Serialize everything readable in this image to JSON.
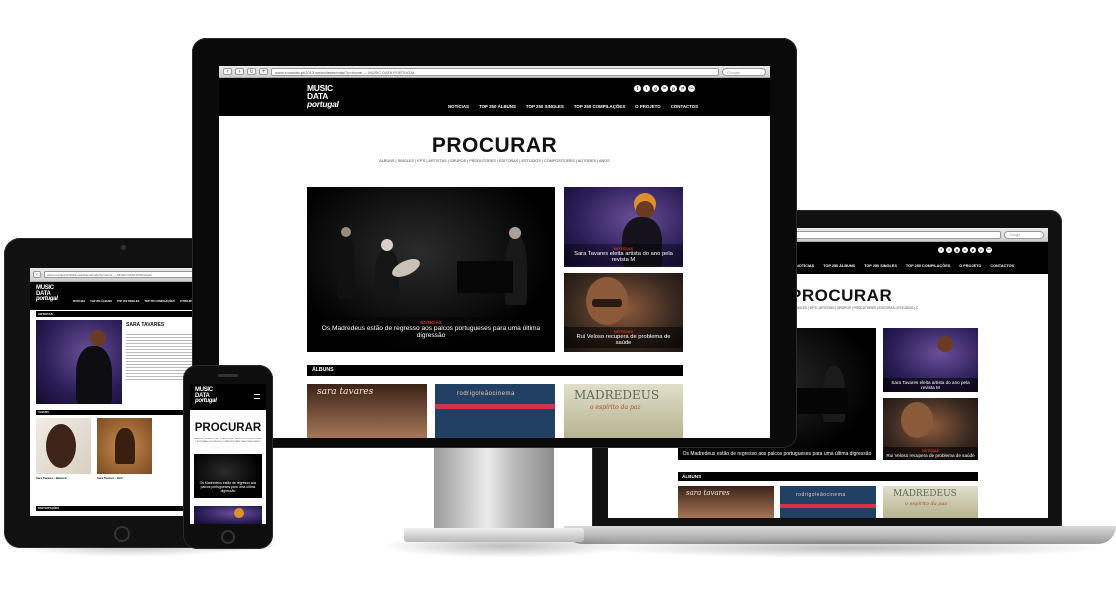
{
  "site": {
    "logo_line1": "MUSIC",
    "logo_line2": "DATA",
    "logo_line3": "portugal",
    "nav": [
      "NOTÍCIAS",
      "TOP 250 ÁLBUNS",
      "TOP 250 SINGLES",
      "TOP 250 COMPILAÇÕES",
      "O PROJETO",
      "CONTACTOS"
    ],
    "social_icons": [
      "f",
      "t",
      "g",
      "in",
      "p",
      "yt",
      "rss"
    ]
  },
  "browser": {
    "url": "www.zoomlab.pt/2013-web/clients/mdp/?p=home — MUSIC DATA PORTUGAL",
    "search_placeholder": "Google"
  },
  "search_page": {
    "title": "PROCURAR",
    "subtitle": "ÁLBUNS | SINGLES | EP'S | ARTISTAS | GRUPOS | PRODUTORES | EDITORAS | ESTÚDIOS | COMPOSITORES | AUTORES | ANOS",
    "features": [
      {
        "tag": "NOTÍCIAS",
        "title": "Os Madredeus estão de regresso aos palcos portugueses para uma última digressão"
      },
      {
        "tag": "NOTÍCIAS",
        "title": "Sara Tavares eleita artista do ano pela revista M"
      },
      {
        "tag": "NOTÍCIAS",
        "title": "Rui Veloso recupera de problema de saúde"
      }
    ],
    "albums_heading": "ÁLBUNS",
    "album_covers": [
      "sara tavares",
      "rodrigoleãocinema",
      "MADREDEUS",
      "o espírito da paz"
    ]
  },
  "tablet_page": {
    "section": "ARTISTAS",
    "artist_name": "SARA TAVARES",
    "albums_heading": "ÁLBUNS",
    "albums": [
      "Sara Tavares  •  Balancê",
      "Sara Tavares  •  Xinti"
    ],
    "bottom_heading": "PARTICIPAÇÕES"
  }
}
